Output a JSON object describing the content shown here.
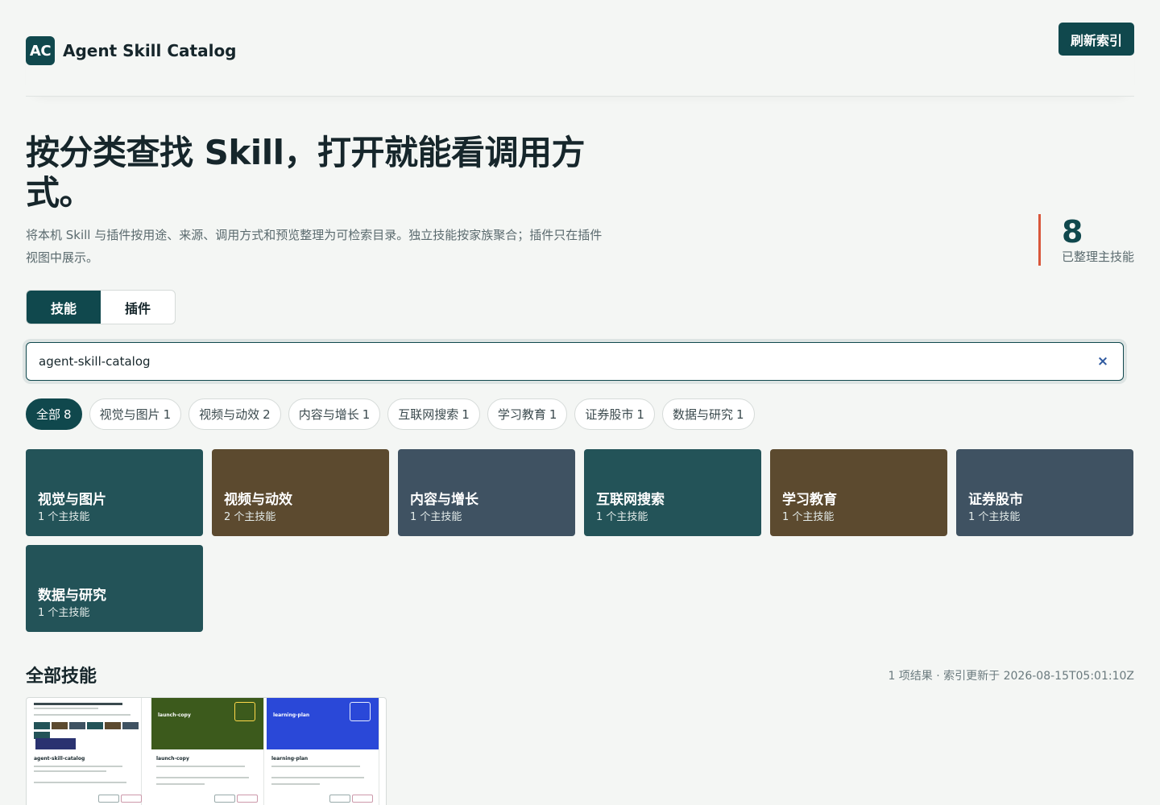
{
  "header": {
    "logo_text": "AC",
    "app_name": "Agent Skill Catalog",
    "refresh_label": "刷新索引"
  },
  "hero": {
    "title": "按分类查找 Skill，打开就能看调用方式。",
    "description": "将本机 Skill 与插件按用途、来源、调用方式和预览整理为可检索目录。独立技能按家族聚合；插件只在插件视图中展示。",
    "stat_value": "8",
    "stat_label": "已整理主技能"
  },
  "view_tabs": [
    {
      "label": "技能",
      "active": true
    },
    {
      "label": "插件",
      "active": false
    }
  ],
  "search": {
    "value": "agent-skill-catalog",
    "clear_symbol": "×"
  },
  "chips": [
    {
      "label": "全部",
      "count": "8",
      "active": true
    },
    {
      "label": "视觉与图片",
      "count": "1"
    },
    {
      "label": "视频与动效",
      "count": "2"
    },
    {
      "label": "内容与增长",
      "count": "1"
    },
    {
      "label": "互联网搜索",
      "count": "1"
    },
    {
      "label": "学习教育",
      "count": "1"
    },
    {
      "label": "证券股市",
      "count": "1"
    },
    {
      "label": "数据与研究",
      "count": "1"
    }
  ],
  "category_tiles": [
    {
      "name": "视觉与图片",
      "count": "1 个主技能",
      "color": "#235358"
    },
    {
      "name": "视频与动效",
      "count": "2 个主技能",
      "color": "#5c4a2f"
    },
    {
      "name": "内容与增长",
      "count": "1 个主技能",
      "color": "#3f5262"
    },
    {
      "name": "互联网搜索",
      "count": "1 个主技能",
      "color": "#235358"
    },
    {
      "name": "学习教育",
      "count": "1 个主技能",
      "color": "#5c4a2f"
    },
    {
      "name": "证券股市",
      "count": "1 个主技能",
      "color": "#3f5262"
    },
    {
      "name": "数据与研究",
      "count": "1 个主技能",
      "color": "#235358"
    }
  ],
  "section": {
    "title": "全部技能",
    "meta": "1 项结果 · 索引更新于 2026-08-15T05:01:10Z"
  },
  "result_card": {
    "previews": [
      {
        "name": "agent-skill-catalog"
      },
      {
        "name": "launch-copy"
      },
      {
        "name": "learning-plan"
      }
    ]
  },
  "colors": {
    "accent": "#10484d",
    "stat_border": "#d9573b",
    "tile_teal": "#235358",
    "tile_brown": "#5c4a2f",
    "tile_slate": "#3f5262"
  }
}
